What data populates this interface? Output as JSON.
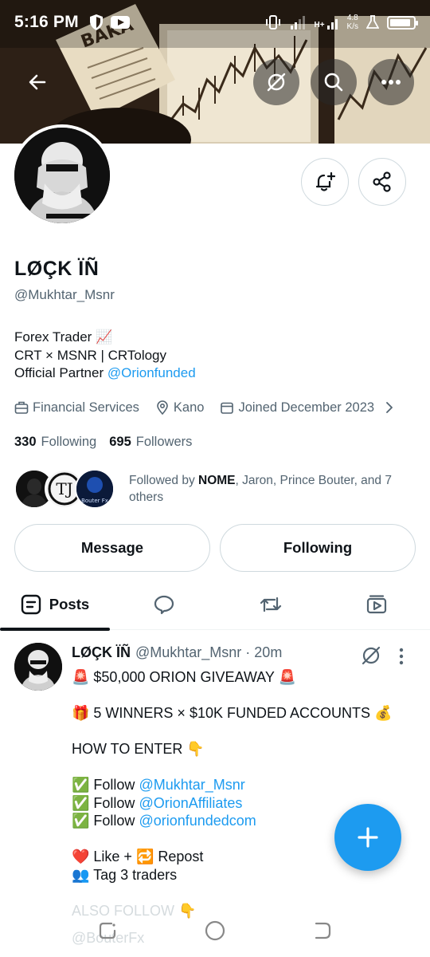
{
  "status_bar": {
    "time": "5:16 PM",
    "network_type": "H+",
    "speed_value": "4.8",
    "speed_unit": "K/s"
  },
  "top_actions": {
    "back_icon": "arrow-left-icon",
    "grok_icon": "grok-icon",
    "search_icon": "search-icon",
    "more_icon": "more-horizontal-icon"
  },
  "profile": {
    "name": "LØÇK ÏÑ",
    "handle": "@Mukhtar_Msnr",
    "bio_line1": "Forex Trader 📈",
    "bio_line2": "CRT × MSNR | CRTology",
    "bio_line3_prefix": "Official Partner ",
    "bio_line3_link": "@Orionfunded",
    "category": "Financial Services",
    "location": "Kano",
    "joined": "Joined December 2023",
    "following_count": "330",
    "following_label": "Following",
    "followers_count": "695",
    "followers_label": "Followers",
    "followed_by_prefix": "Followed by ",
    "followed_by_bold": "NOME",
    "followed_by_rest": ", Jaron, Prince Bouter, and 7 others",
    "mini_avatar_3_text": "Bouter Fx"
  },
  "buttons": {
    "message": "Message",
    "following": "Following"
  },
  "tabs": {
    "posts": "Posts"
  },
  "post": {
    "name": "LØÇK ÏÑ",
    "meta": "@Mukhtar_Msnr · 20m",
    "line1": "🚨 $50,000 ORION GIVEAWAY 🚨",
    "line2": "🎁 5 WINNERS × $10K FUNDED ACCOUNTS 💰",
    "line3": "HOW TO ENTER 👇",
    "follow_prefix": "✅ Follow ",
    "follow1": "@Mukhtar_Msnr",
    "follow2": "@OrionAffiliates",
    "follow3": "@orionfundedcom",
    "line7": "❤️ Like + 🔁 Repost",
    "line8": "👥 Tag 3 traders",
    "line9": "ALSO FOLLOW 👇",
    "line10": "@BouterFx"
  },
  "colors": {
    "accent": "#1d9bf0",
    "text": "#0f1419",
    "muted": "#536471",
    "border": "#cfd9de"
  },
  "battery_level": 0.9
}
